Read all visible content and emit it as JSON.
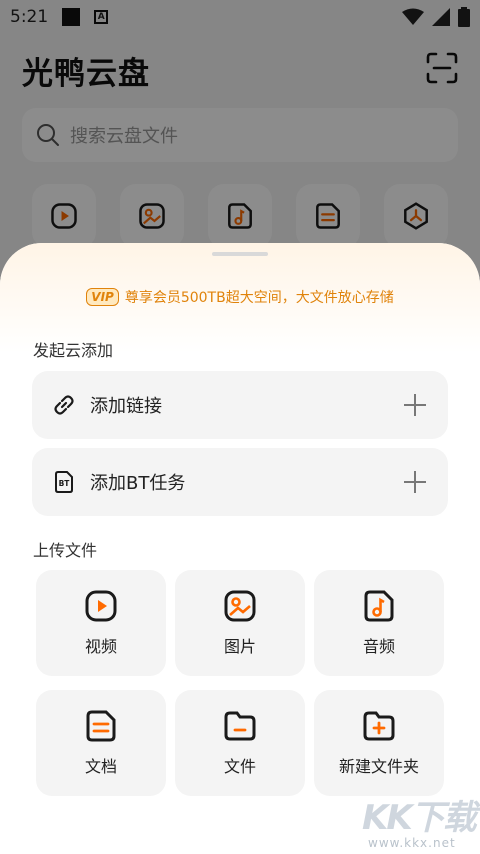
{
  "status_bar": {
    "time": "5:21"
  },
  "app": {
    "title": "光鸭云盘"
  },
  "search": {
    "placeholder": "搜索云盘文件"
  },
  "shortcuts": [
    "video-icon",
    "image-icon",
    "music-icon",
    "document-icon",
    "torrent-icon"
  ],
  "sheet": {
    "vip": {
      "badge": "VIP",
      "text": "尊享会员500TB超大空间，大文件放心存储"
    },
    "cloud_add": {
      "title": "发起云添加",
      "items": [
        {
          "label": "添加链接",
          "icon": "link-icon"
        },
        {
          "label": "添加BT任务",
          "icon": "bt-icon"
        }
      ]
    },
    "upload": {
      "title": "上传文件",
      "items": [
        {
          "label": "视频",
          "icon": "video-icon"
        },
        {
          "label": "图片",
          "icon": "image-icon"
        },
        {
          "label": "音频",
          "icon": "music-icon"
        },
        {
          "label": "文档",
          "icon": "document-icon"
        },
        {
          "label": "文件",
          "icon": "folder-icon"
        },
        {
          "label": "新建文件夹",
          "icon": "new-folder-icon"
        }
      ]
    }
  },
  "watermark": {
    "brand": "KK下载",
    "url": "www.kkx.net"
  },
  "colors": {
    "accent": "#ff6a00",
    "vip": "#e0830b",
    "tile_bg": "#f4f4f4"
  }
}
